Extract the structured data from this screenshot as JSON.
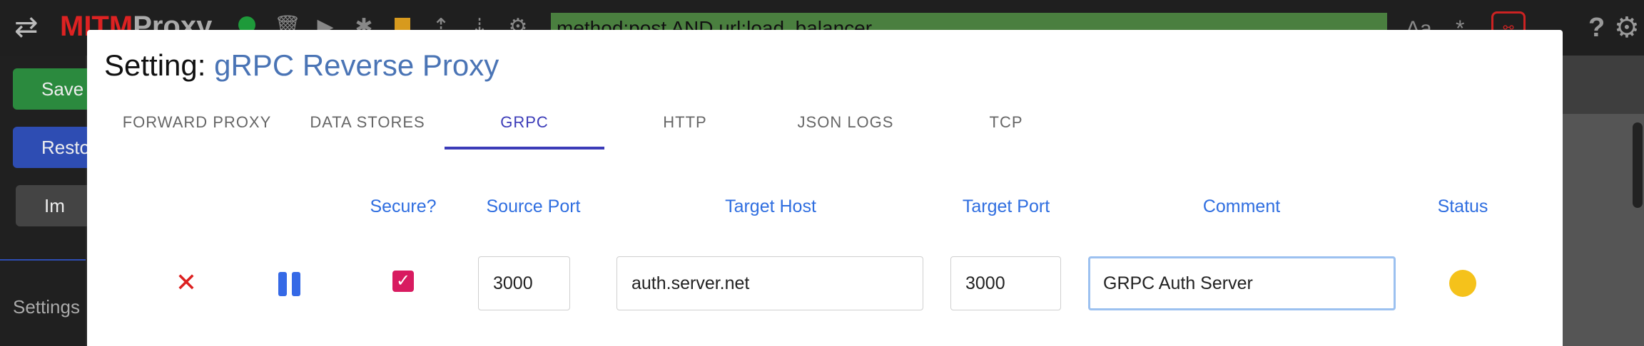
{
  "topbar": {
    "brand_part1": "MITM",
    "brand_part2": "Proxy",
    "filter_value": "method:post AND url:load_balancer",
    "case_label": "Aa",
    "regex_label": "*",
    "help_label": "?"
  },
  "sidebar": {
    "save_label": "Save",
    "restore_label": "Restore",
    "import_label": "Im",
    "settings_label": "Settings"
  },
  "dialog": {
    "title_prefix": "Setting: ",
    "title_name": "gRPC Reverse Proxy",
    "tabs": [
      {
        "label": "FORWARD PROXY"
      },
      {
        "label": "DATA STORES"
      },
      {
        "label": "GRPC",
        "active": true
      },
      {
        "label": "HTTP"
      },
      {
        "label": "JSON LOGS"
      },
      {
        "label": "TCP"
      }
    ],
    "columns": {
      "secure": "Secure?",
      "source_port": "Source Port",
      "target_host": "Target Host",
      "target_port": "Target Port",
      "comment": "Comment",
      "status": "Status"
    },
    "rows": [
      {
        "secure": true,
        "source_port": "3000",
        "target_host": "auth.server.net",
        "target_port": "3000",
        "comment": "GRPC Auth Server",
        "status_color": "#f5c21b"
      }
    ]
  },
  "colors": {
    "accent_blue": "#2f6ee0",
    "tab_active": "#3b3bb8",
    "remove_red": "#dd2020",
    "checkbox_pink": "#d81b60",
    "status_yellow": "#f5c21b"
  }
}
